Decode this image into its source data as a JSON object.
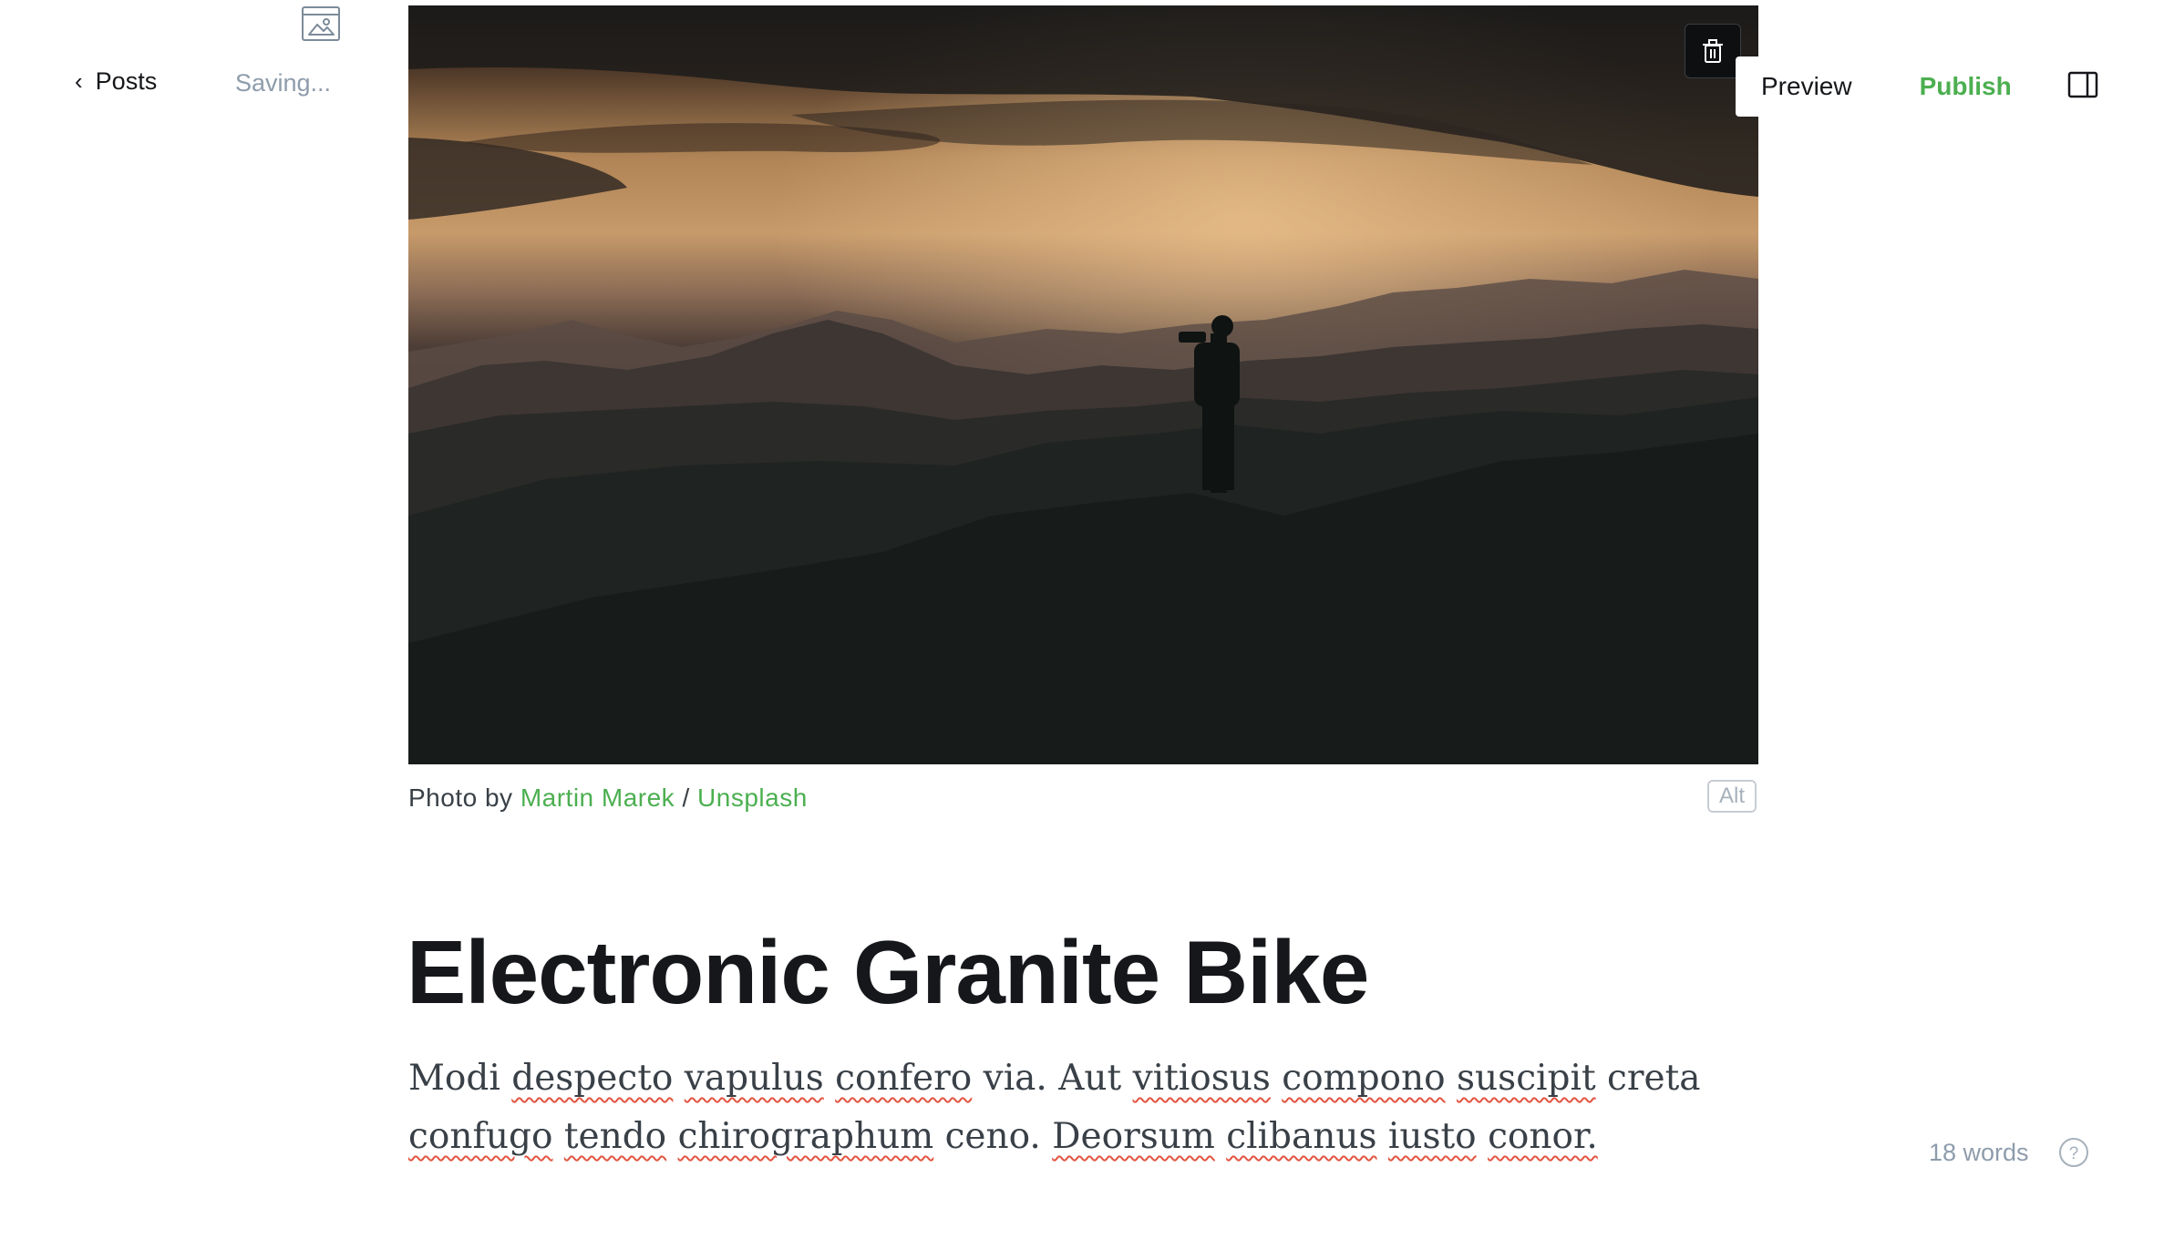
{
  "header": {
    "back_label": "Posts",
    "status": "Saving...",
    "preview_label": "Preview",
    "publish_label": "Publish",
    "icons": {
      "back": "chevron-left-icon",
      "feature_image": "image-icon",
      "sidebar": "sidebar-toggle-icon"
    }
  },
  "feature_image": {
    "caption_prefix": "Photo by",
    "author": "Martin Marek",
    "separator": "/",
    "source": "Unsplash",
    "alt_label": "Alt",
    "delete_icon": "trash-icon"
  },
  "post": {
    "title": "Electronic Granite Bike",
    "body_words": [
      "Modi",
      "despecto",
      "vapulus",
      "confero",
      "via.",
      "Aut",
      "vitiosus",
      "compono",
      "suscipit",
      "creta",
      "confugo",
      "tendo",
      "chirographum",
      "ceno.",
      "Deorsum",
      "clibanus",
      "iusto",
      "conor."
    ]
  },
  "footer": {
    "word_count": "18 words",
    "help_icon": "help-circle-icon"
  },
  "colors": {
    "accent": "#4caf50",
    "muted": "#8e9cac",
    "text": "#15171a",
    "spellcheck": "#e25440"
  }
}
